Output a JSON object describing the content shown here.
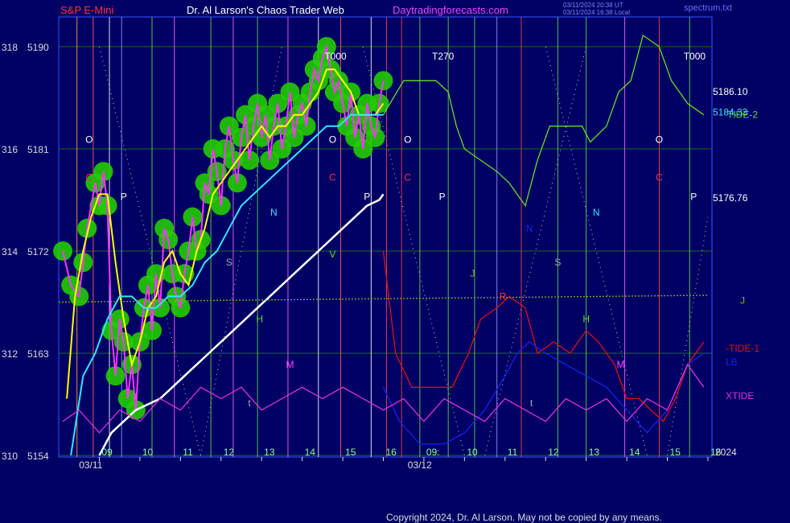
{
  "header": {
    "instrument": "S&P E-Mini",
    "title": "Dr. Al Larson's Chaos Trader Web",
    "site": "Daytradingforecasts.com",
    "stamp_line1": "03/11/2024 20:38 UT",
    "stamp_line2": "03/11/2024 16:38 Local",
    "source": "spectrum.txt"
  },
  "copyright": "Copyright 2024, Dr. Al Larson. May not be copied by any means.",
  "colors": {
    "background": "#000064",
    "price": "#ff33ff",
    "fast_avg": "#ffff00",
    "slow_avg": "#33e5ff",
    "long_avg": "#ffffff",
    "tide2": "#66dd22",
    "tide1": "#dd1111",
    "lb": "#1122ee",
    "xtide": "#dd33dd",
    "jline": "#88aa22",
    "bubbles": "#22cc00",
    "title_red": "#ff3333",
    "title_white": "#ffffff",
    "title_magenta": "#ee44ff"
  },
  "chart_data": {
    "type": "line",
    "title": "Dr. Al Larson's Chaos Trader Web",
    "x_unit": "hour (ET)",
    "y_left_outer_ticks": [
      "318",
      "316",
      "314",
      "312",
      "310"
    ],
    "y_left_ticks": [
      5190,
      5181,
      5172,
      5163,
      5154
    ],
    "ylim": [
      5154,
      5194
    ],
    "x_ticks": [
      {
        "label": "09",
        "t": 9
      },
      {
        "label": "10",
        "t": 10
      },
      {
        "label": "11",
        "t": 11
      },
      {
        "label": "12",
        "t": 12
      },
      {
        "label": "13",
        "t": 13
      },
      {
        "label": "14",
        "t": 14
      },
      {
        "label": "15",
        "t": 15
      },
      {
        "label": "16",
        "t": 16
      },
      {
        "label": "09:",
        "t": 17
      },
      {
        "label": "10",
        "t": 18
      },
      {
        "label": "11",
        "t": 19
      },
      {
        "label": "12",
        "t": 20
      },
      {
        "label": "13",
        "t": 21
      },
      {
        "label": "14",
        "t": 22
      },
      {
        "label": "15",
        "t": 23
      },
      {
        "label": "16",
        "t": 24
      }
    ],
    "date_labels": [
      {
        "label": "03/11",
        "t": 8.5
      },
      {
        "label": "03/12",
        "t": 16.6
      }
    ],
    "year_label": "2024",
    "right_values": [
      {
        "label": "5186.10",
        "y": 5186.1,
        "color": "#ffffff"
      },
      {
        "label": "5184.33",
        "y": 5184.3,
        "color": "#33e5ff"
      },
      {
        "label": "5176.76",
        "y": 5176.76,
        "color": "#ffffff"
      }
    ],
    "right_series_labels": [
      {
        "label": "TIDE-2",
        "y": 5184.1,
        "color": "#66dd22"
      },
      {
        "label": "J",
        "y": 5167.7,
        "color": "#88aa22"
      },
      {
        "label": "-TIDE-1",
        "y": 5163.5,
        "color": "#dd1111"
      },
      {
        "label": "LB",
        "y": 5162.3,
        "color": "#1122ee"
      },
      {
        "label": "XTIDE",
        "y": 5159.3,
        "color": "#dd33dd"
      }
    ],
    "top_markers": [
      {
        "label": "T000",
        "t": 14.55
      },
      {
        "label": "T270",
        "t": 17.2
      },
      {
        "label": "T000",
        "t": 23.4
      }
    ],
    "vertical_lines": [
      {
        "t": 8.45,
        "color": "#ffaa44"
      },
      {
        "t": 8.85,
        "color": "#ff6666"
      },
      {
        "t": 9.25,
        "color": "#ffffff"
      },
      {
        "t": 9.55,
        "color": "#9999ff"
      },
      {
        "t": 10.3,
        "color": "#66dd44"
      },
      {
        "t": 10.85,
        "color": "#ff66ff"
      },
      {
        "t": 11.75,
        "color": "#66dd44"
      },
      {
        "t": 12.3,
        "color": "#ff66ff"
      },
      {
        "t": 12.9,
        "color": "#66dd44"
      },
      {
        "t": 13.65,
        "color": "#ff66ff"
      },
      {
        "t": 14.4,
        "color": "#ffffff"
      },
      {
        "t": 14.95,
        "color": "#ff6666"
      },
      {
        "t": 15.7,
        "color": "#ffffff"
      },
      {
        "t": 16.08,
        "color": "#ff4444"
      },
      {
        "t": 16.45,
        "color": "#ff4444"
      },
      {
        "t": 16.9,
        "color": "#66dd44"
      },
      {
        "t": 17.6,
        "color": "#66dd44"
      },
      {
        "t": 18.25,
        "color": "#66dd44"
      },
      {
        "t": 18.8,
        "color": "#9999ff"
      },
      {
        "t": 19.4,
        "color": "#ff4444"
      },
      {
        "t": 20.3,
        "color": "#66dd44"
      },
      {
        "t": 21.0,
        "color": "#66dd44"
      },
      {
        "t": 21.95,
        "color": "#ff66ff"
      },
      {
        "t": 22.8,
        "color": "#ff4444"
      },
      {
        "t": 23.55,
        "color": "#66dd44"
      }
    ],
    "planet_letters": [
      {
        "label": "O",
        "t": 8.75,
        "y": 5181.8,
        "color": "#ffffff"
      },
      {
        "label": "C",
        "t": 8.75,
        "y": 5178.5,
        "color": "#ff3333"
      },
      {
        "label": "P",
        "t": 9.6,
        "y": 5176.8,
        "color": "#ffffff"
      },
      {
        "label": "S",
        "t": 12.2,
        "y": 5171.0,
        "color": "#aaaaaa"
      },
      {
        "label": "N",
        "t": 13.3,
        "y": 5175.4,
        "color": "#33e5ff"
      },
      {
        "label": "H",
        "t": 12.95,
        "y": 5166.0,
        "color": "#66dd22"
      },
      {
        "label": "M",
        "t": 13.7,
        "y": 5162.0,
        "color": "#ff44ff"
      },
      {
        "label": "t",
        "t": 12.7,
        "y": 5158.6,
        "color": "#aaaaaa"
      },
      {
        "label": "V",
        "t": 14.75,
        "y": 5171.7,
        "color": "#66dd22"
      },
      {
        "label": "O",
        "t": 14.75,
        "y": 5181.8,
        "color": "#ffffff"
      },
      {
        "label": "C",
        "t": 14.75,
        "y": 5178.5,
        "color": "#ff3333"
      },
      {
        "label": "P",
        "t": 15.6,
        "y": 5176.8,
        "color": "#ffffff"
      },
      {
        "label": "O",
        "t": 16.6,
        "y": 5181.8,
        "color": "#ffffff"
      },
      {
        "label": "C",
        "t": 16.6,
        "y": 5178.5,
        "color": "#ff3333"
      },
      {
        "label": "P",
        "t": 17.45,
        "y": 5176.8,
        "color": "#ffffff"
      },
      {
        "label": "J",
        "t": 18.2,
        "y": 5170.0,
        "color": "#88aa22"
      },
      {
        "label": "R",
        "t": 18.95,
        "y": 5168.0,
        "color": "#ff3333"
      },
      {
        "label": "N",
        "t": 19.6,
        "y": 5174.0,
        "color": "#1122ee"
      },
      {
        "label": "S",
        "t": 20.3,
        "y": 5171.0,
        "color": "#aaaaaa"
      },
      {
        "label": "t",
        "t": 19.65,
        "y": 5158.6,
        "color": "#aaaaaa"
      },
      {
        "label": "H",
        "t": 21.0,
        "y": 5166.0,
        "color": "#66dd22"
      },
      {
        "label": "N",
        "t": 21.25,
        "y": 5175.4,
        "color": "#33e5ff"
      },
      {
        "label": "M",
        "t": 21.85,
        "y": 5162.0,
        "color": "#ff44ff"
      },
      {
        "label": "O",
        "t": 22.8,
        "y": 5181.8,
        "color": "#ffffff"
      },
      {
        "label": "C",
        "t": 22.8,
        "y": 5178.5,
        "color": "#ff3333"
      },
      {
        "label": "P",
        "t": 23.65,
        "y": 5176.8,
        "color": "#ffffff"
      }
    ],
    "series": [
      {
        "name": "price",
        "color": "#ff33ff",
        "t": [
          8.1,
          8.3,
          8.5,
          8.6,
          8.7,
          8.9,
          9.0,
          9.1,
          9.2,
          9.3,
          9.4,
          9.5,
          9.6,
          9.7,
          9.8,
          9.9,
          10.0,
          10.1,
          10.2,
          10.3,
          10.4,
          10.5,
          10.6,
          10.7,
          10.8,
          10.9,
          11.0,
          11.1,
          11.2,
          11.3,
          11.4,
          11.5,
          11.6,
          11.7,
          11.8,
          11.9,
          12.0,
          12.1,
          12.2,
          12.3,
          12.4,
          12.5,
          12.6,
          12.7,
          12.8,
          12.9,
          13.0,
          13.1,
          13.2,
          13.3,
          13.4,
          13.5,
          13.6,
          13.7,
          13.8,
          13.9,
          14.0,
          14.1,
          14.2,
          14.3,
          14.4,
          14.5,
          14.6,
          14.7,
          14.8,
          14.9,
          15.0,
          15.1,
          15.2,
          15.3,
          15.4,
          15.5,
          15.6,
          15.7,
          15.8,
          15.9,
          16.0
        ],
        "values": [
          5172,
          5169,
          5168,
          5171,
          5174,
          5178,
          5176,
          5179,
          5176,
          5165,
          5161,
          5166,
          5164,
          5159,
          5162,
          5158,
          5164,
          5167,
          5169,
          5165,
          5170,
          5167,
          5174,
          5173,
          5170,
          5168,
          5167,
          5170,
          5172,
          5175,
          5172,
          5173,
          5178,
          5177,
          5181,
          5179,
          5176,
          5181,
          5183,
          5180,
          5178,
          5182,
          5184,
          5180,
          5183,
          5185,
          5182,
          5184,
          5180,
          5183,
          5185,
          5181,
          5183,
          5186,
          5182,
          5184,
          5185,
          5183,
          5186,
          5188,
          5187,
          5189,
          5190,
          5188,
          5186,
          5187,
          5185,
          5183,
          5186,
          5182,
          5184,
          5181,
          5185,
          5183,
          5182,
          5185,
          5187
        ]
      },
      {
        "name": "fast_avg",
        "color": "#ffff00",
        "t": [
          8.2,
          8.4,
          8.6,
          8.8,
          9.0,
          9.2,
          9.4,
          9.6,
          9.8,
          10.0,
          10.2,
          10.4,
          10.6,
          10.8,
          11.0,
          11.2,
          11.4,
          11.6,
          11.8,
          12.0,
          12.2,
          12.4,
          12.6,
          12.8,
          13.0,
          13.2,
          13.4,
          13.6,
          13.8,
          14.0,
          14.2,
          14.4,
          14.6,
          14.8,
          15.0,
          15.2,
          15.4,
          15.6,
          15.8,
          16.0
        ],
        "values": [
          5159,
          5168,
          5172,
          5175,
          5177,
          5177,
          5171,
          5166,
          5162,
          5164,
          5167,
          5168,
          5171,
          5172,
          5170,
          5169,
          5172,
          5174,
          5177,
          5178,
          5179,
          5180,
          5181,
          5182,
          5183,
          5182,
          5183,
          5183,
          5184,
          5184,
          5185,
          5186,
          5188,
          5188,
          5187,
          5186,
          5184,
          5184,
          5184,
          5185
        ]
      },
      {
        "name": "slow_avg",
        "color": "#33e5ff",
        "t": [
          8.3,
          8.6,
          8.9,
          9.2,
          9.5,
          9.8,
          10.1,
          10.4,
          10.7,
          11.0,
          11.3,
          11.6,
          11.9,
          12.2,
          12.5,
          12.8,
          13.1,
          13.4,
          13.7,
          14.0,
          14.3,
          14.6,
          14.9,
          15.2,
          15.5,
          15.8,
          16.0
        ],
        "values": [
          5154,
          5161,
          5163,
          5166,
          5168,
          5168,
          5167,
          5167,
          5168,
          5168,
          5169,
          5171,
          5172,
          5174,
          5176,
          5177,
          5178,
          5179,
          5180,
          5181,
          5182,
          5183,
          5183,
          5184,
          5184,
          5184,
          5184
        ]
      },
      {
        "name": "long_avg",
        "color": "#ffffff",
        "t": [
          9.0,
          9.3,
          9.6,
          9.9,
          10.2,
          10.5,
          10.8,
          11.1,
          11.4,
          11.7,
          12.0,
          12.3,
          12.6,
          12.9,
          13.2,
          13.5,
          13.8,
          14.1,
          14.4,
          14.7,
          15.0,
          15.3,
          15.6,
          15.9,
          16.0
        ],
        "values": [
          5154,
          5156,
          5157,
          5158,
          5158.5,
          5159,
          5160,
          5161,
          5162,
          5163,
          5164,
          5165,
          5166,
          5167,
          5168,
          5169,
          5170,
          5171,
          5172,
          5173,
          5174,
          5175,
          5176,
          5176.5,
          5177
        ]
      },
      {
        "name": "TIDE-2",
        "color": "#66dd22",
        "t": [
          16.0,
          16.5,
          16.9,
          17.3,
          17.6,
          17.8,
          18.0,
          18.4,
          18.8,
          19.1,
          19.5,
          19.8,
          20.1,
          20.5,
          20.9,
          21.1,
          21.5,
          21.8,
          22.1,
          22.4,
          22.8,
          23.1,
          23.5,
          23.9
        ],
        "values": [
          5184,
          5187,
          5187,
          5187,
          5186,
          5183,
          5181,
          5180,
          5179,
          5178,
          5176,
          5180,
          5183,
          5183,
          5183,
          5181.6,
          5183,
          5186,
          5187,
          5191,
          5190,
          5187,
          5185,
          5184
        ]
      },
      {
        "name": "-TIDE-1",
        "color": "#dd1111",
        "t": [
          16.0,
          16.3,
          16.7,
          17.2,
          17.7,
          18.1,
          18.4,
          18.8,
          19.1,
          19.5,
          19.8,
          20.2,
          20.6,
          21.0,
          21.3,
          21.7,
          22.0,
          22.3,
          22.6,
          22.9,
          23.2,
          23.5,
          23.9
        ],
        "values": [
          5172,
          5163,
          5160,
          5160,
          5160,
          5163,
          5166,
          5167,
          5168,
          5167,
          5163,
          5164,
          5163,
          5165,
          5164,
          5162,
          5159,
          5159,
          5158,
          5157,
          5159,
          5162,
          5164
        ]
      },
      {
        "name": "LB",
        "color": "#1122ee",
        "t": [
          16.0,
          16.4,
          16.9,
          17.5,
          18.0,
          18.5,
          19.0,
          19.3,
          19.6,
          20.0,
          20.5,
          21.0,
          21.5,
          22.0,
          22.5,
          23.0,
          23.5,
          23.9
        ],
        "values": [
          5160,
          5157,
          5155,
          5155,
          5156,
          5158,
          5161,
          5163,
          5164,
          5163,
          5162,
          5161,
          5160,
          5158,
          5156,
          5158,
          5162,
          5163
        ]
      },
      {
        "name": "XTIDE",
        "color": "#dd33dd",
        "t": [
          8.1,
          8.5,
          9.0,
          9.5,
          10.0,
          10.5,
          11.0,
          11.5,
          12.0,
          12.5,
          13.0,
          13.5,
          14.0,
          14.5,
          15.0,
          15.5,
          16.0,
          16.5,
          17.0,
          17.5,
          18.0,
          18.5,
          19.0,
          19.5,
          20.0,
          20.5,
          21.0,
          21.5,
          22.0,
          22.5,
          23.0,
          23.5,
          23.9
        ],
        "values": [
          5157,
          5158,
          5156,
          5158,
          5157,
          5159,
          5158,
          5160,
          5159,
          5160,
          5158,
          5159,
          5160,
          5159,
          5160,
          5159,
          5158,
          5159,
          5157,
          5159,
          5158,
          5157,
          5159,
          5158,
          5157,
          5159,
          5158,
          5159,
          5157,
          5159,
          5158,
          5162,
          5160
        ]
      },
      {
        "name": "J",
        "color": "#88aa22",
        "t": [
          8.0,
          24.0
        ],
        "values": [
          5167.5,
          5168.1
        ]
      }
    ]
  }
}
